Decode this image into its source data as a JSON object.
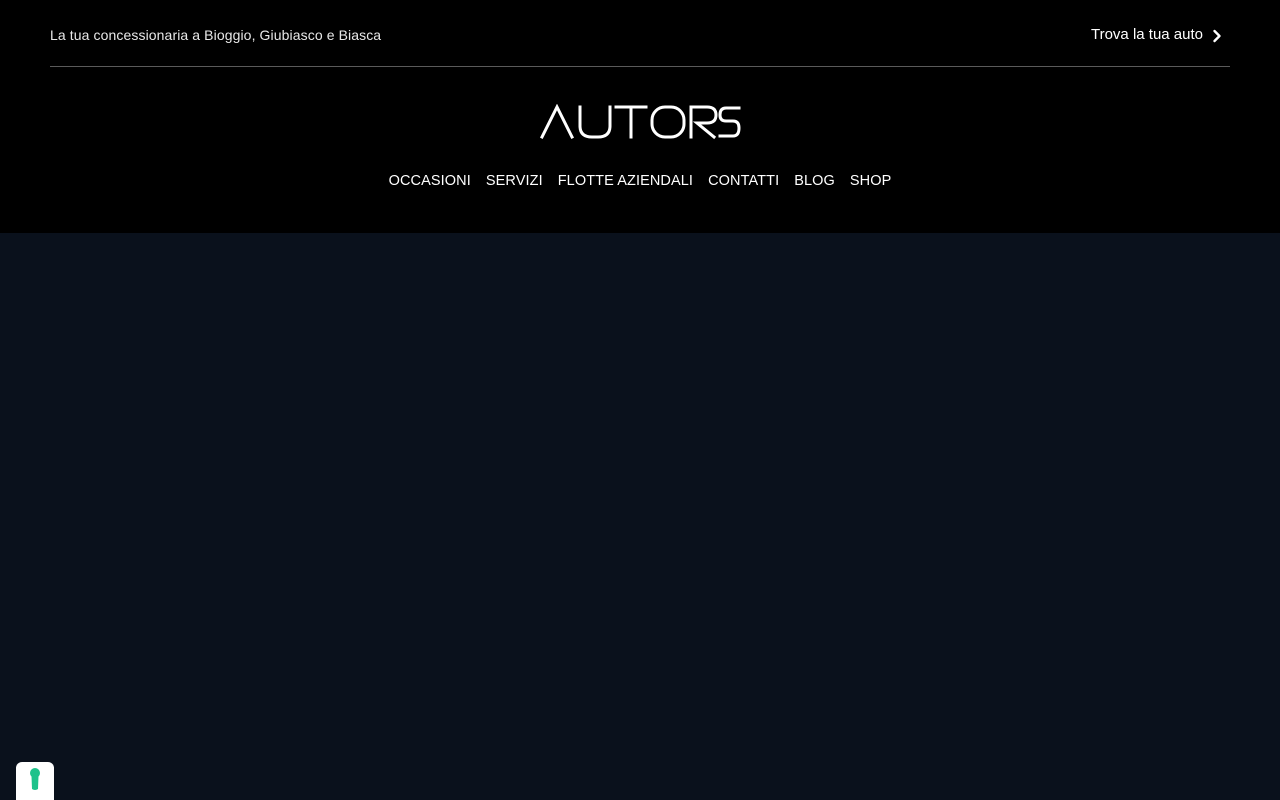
{
  "topbar": {
    "tagline": "La tua concessionaria a Bioggio, Giubiasco e Biasca",
    "find_car_label": "Trova la tua auto",
    "find_car_icon": "chevron-right-icon"
  },
  "brand": {
    "logo_text": "AUTORS"
  },
  "nav": {
    "items": [
      {
        "label": "OCCASIONI"
      },
      {
        "label": "SERVIZI"
      },
      {
        "label": "FLOTTE AZIENDALI"
      },
      {
        "label": "CONTATTI"
      },
      {
        "label": "BLOG"
      },
      {
        "label": "SHOP"
      }
    ]
  },
  "cookie_widget": {
    "icon": "keyhole-icon",
    "accent_color": "#1ec28b"
  },
  "colors": {
    "header_background": "#000000",
    "hero_background": "#0a111c",
    "text": "#ffffff"
  }
}
